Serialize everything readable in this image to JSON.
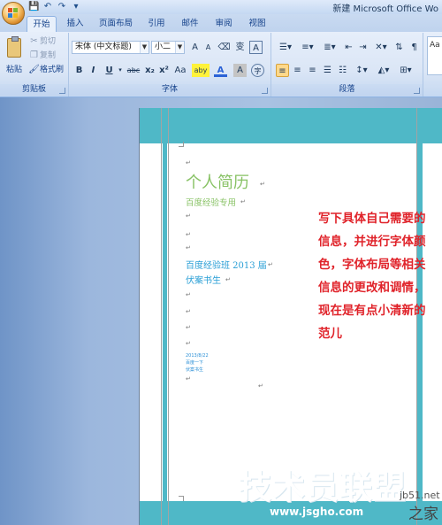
{
  "window": {
    "title": "新建 Microsoft Office Wo"
  },
  "quick_access": {
    "icons": [
      "save-icon",
      "undo-icon",
      "redo-icon",
      "customize-icon"
    ]
  },
  "tabs": [
    {
      "label": "开始",
      "active": true
    },
    {
      "label": "插入"
    },
    {
      "label": "页面布局"
    },
    {
      "label": "引用"
    },
    {
      "label": "邮件"
    },
    {
      "label": "审阅"
    },
    {
      "label": "视图"
    }
  ],
  "ribbon": {
    "clipboard": {
      "label": "剪贴板",
      "paste": "粘贴",
      "cut": "剪切",
      "copy": "复制",
      "format_painter": "格式刷"
    },
    "font": {
      "label": "字体",
      "font_name": "宋体 (中文标题)",
      "font_size": "小二",
      "bold": "B",
      "italic": "I",
      "underline": "U",
      "strikethrough": "abc",
      "subscript": "x₂",
      "superscript": "x²",
      "change_case": "Aa",
      "grow": "A",
      "shrink": "A",
      "phonetic": "变",
      "char_border": "A",
      "highlight": "aby",
      "font_color": "A",
      "char_shading": "A",
      "enclose": "字"
    },
    "paragraph": {
      "label": "段落"
    },
    "styles": {
      "preview": "Aa"
    }
  },
  "document": {
    "title": "个人简历",
    "subtitle": "百度经验专用",
    "line1": "百度经验班 2013 届",
    "line2": "伏案书生",
    "small1": "2013/8/22",
    "small2": "百度一下",
    "small3": "伏案书生"
  },
  "annotation": {
    "lines": [
      "写下具体自己需要的",
      "信息，并进行字体颜",
      "色，字体布局等相关",
      "信息的更改和调情，",
      "现在是有点小清新的",
      "范儿"
    ]
  },
  "watermark": {
    "main": "技术员联盟",
    "site": "jb51.net",
    "suffix": "之家",
    "url": "www.jsgho.com"
  },
  "colors": {
    "accent_teal": "#4fb8c7",
    "title_green": "#88c265",
    "text_blue": "#2a9fd6",
    "annotation_red": "#e0232a"
  }
}
